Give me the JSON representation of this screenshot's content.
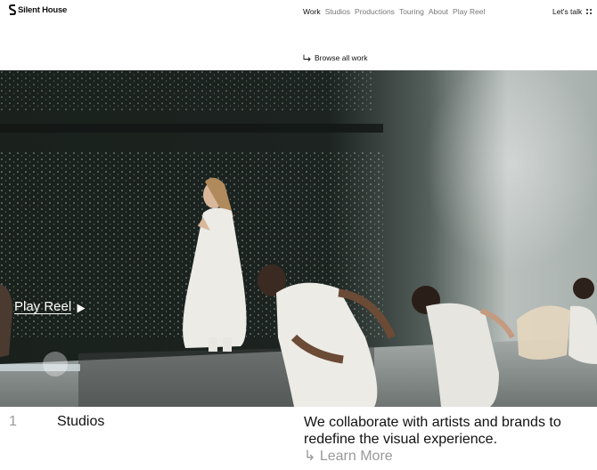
{
  "header": {
    "logo_text": "Silent House",
    "nav": [
      {
        "label": "Work",
        "active": true
      },
      {
        "label": "Studios",
        "active": false
      },
      {
        "label": "Productions",
        "active": false
      },
      {
        "label": "Touring",
        "active": false
      },
      {
        "label": "About",
        "active": false
      },
      {
        "label": "Play Reel",
        "active": false
      }
    ],
    "cta_label": "Let's talk",
    "menu_icon": "grid-dots-icon"
  },
  "browse": {
    "label": "Browse all work",
    "icon": "arrow-down-right-icon"
  },
  "hero": {
    "play_label": "Play Reel",
    "play_icon": "play-triangle-icon"
  },
  "section": {
    "number": "1",
    "name": "Studios",
    "tagline": "We collaborate with artists and brands to redefine the visual experience.",
    "link_arrow": "↳",
    "link_label": "Learn More"
  },
  "colors": {
    "text": "#111111",
    "muted": "#999999",
    "background": "#ffffff"
  }
}
